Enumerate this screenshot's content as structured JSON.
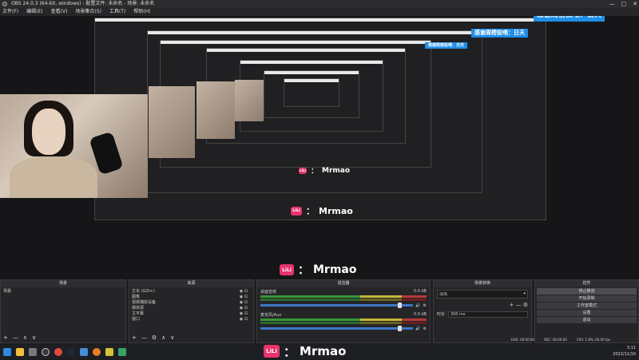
{
  "window": {
    "title": "OBS 24.0.3 (64-bit, windows) - 配置文件: 未命名 - 场景: 未命名",
    "controls": [
      "—",
      "□",
      "✕"
    ]
  },
  "menu": [
    "文件(F)",
    "编辑(E)",
    "查看(V)",
    "场景集合(S)",
    "工具(T)",
    "帮助(H)"
  ],
  "overlay": {
    "donor_text": "感谢周榜投喂：日天",
    "brand_logo": "LiLi",
    "brand_sep": "：",
    "brand_name": "Mrmao"
  },
  "panels": {
    "scenes": {
      "header": "场景",
      "items": [
        "场景"
      ],
      "footer": [
        "+",
        "—",
        "∧",
        "∨"
      ]
    },
    "sources": {
      "header": "来源",
      "items": [
        "文本 (GDI+)",
        "图像",
        "视频捕获设备",
        "媒体源",
        "主字幕",
        "窗口"
      ],
      "footer": [
        "+",
        "—",
        "⚙",
        "∧",
        "∨"
      ]
    },
    "mixer": {
      "header": "混音器",
      "channels": [
        {
          "name": "桌面音频",
          "db": "0.0 dB",
          "level": 0.72
        },
        {
          "name": "麦克风/Aux",
          "db": "0.0 dB",
          "level": 0.68
        }
      ]
    },
    "transitions": {
      "header": "场景转换",
      "selected": "淡出",
      "duration_label": "时长",
      "duration_value": "300 ms"
    },
    "controls": {
      "header": "控件",
      "buttons": [
        "停止推流",
        "开始录制",
        "工作室模式",
        "设置",
        "退出"
      ]
    }
  },
  "status": {
    "live": "LIVE: 00:00:00",
    "rec": "REC: 00:00:00",
    "cpu": "CPU: 1.8%, 60.00 fps"
  },
  "taskbar": {
    "time": "3:11",
    "date": "2022/11/10"
  },
  "colors": {
    "accent_blue": "#1e8ee8",
    "brand_pink": "#e8336d",
    "meter_green": "#3aa33a",
    "meter_yellow": "#d6c83a",
    "meter_red": "#c63a3a"
  }
}
